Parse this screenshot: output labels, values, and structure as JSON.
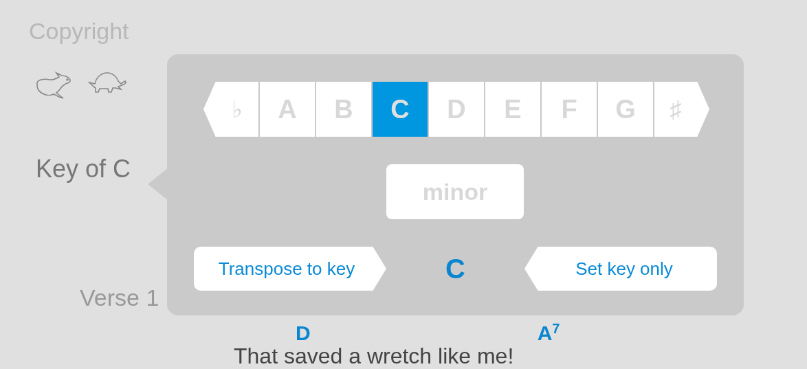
{
  "song": {
    "copyright": "Copyright",
    "key_label": "Key of C",
    "section": "Verse 1",
    "chords": [
      "D",
      "A$^{7}$"
    ],
    "lyric": "That saved a wretch like me!"
  },
  "key_popover": {
    "keys": [
      {
        "label": "♭",
        "kind": "flat",
        "selected": false
      },
      {
        "label": "A",
        "kind": "note",
        "selected": false
      },
      {
        "label": "B",
        "kind": "note",
        "selected": false
      },
      {
        "label": "C",
        "kind": "note",
        "selected": true
      },
      {
        "label": "D",
        "kind": "note",
        "selected": false
      },
      {
        "label": "E",
        "kind": "note",
        "selected": false
      },
      {
        "label": "F",
        "kind": "note",
        "selected": false
      },
      {
        "label": "G",
        "kind": "note",
        "selected": false
      },
      {
        "label": "♯",
        "kind": "sharp",
        "selected": false
      }
    ],
    "mode_button": {
      "label": "minor",
      "selected": false
    },
    "transpose_button": "Transpose to key",
    "current_key": "C",
    "set_key_button": "Set key only"
  }
}
